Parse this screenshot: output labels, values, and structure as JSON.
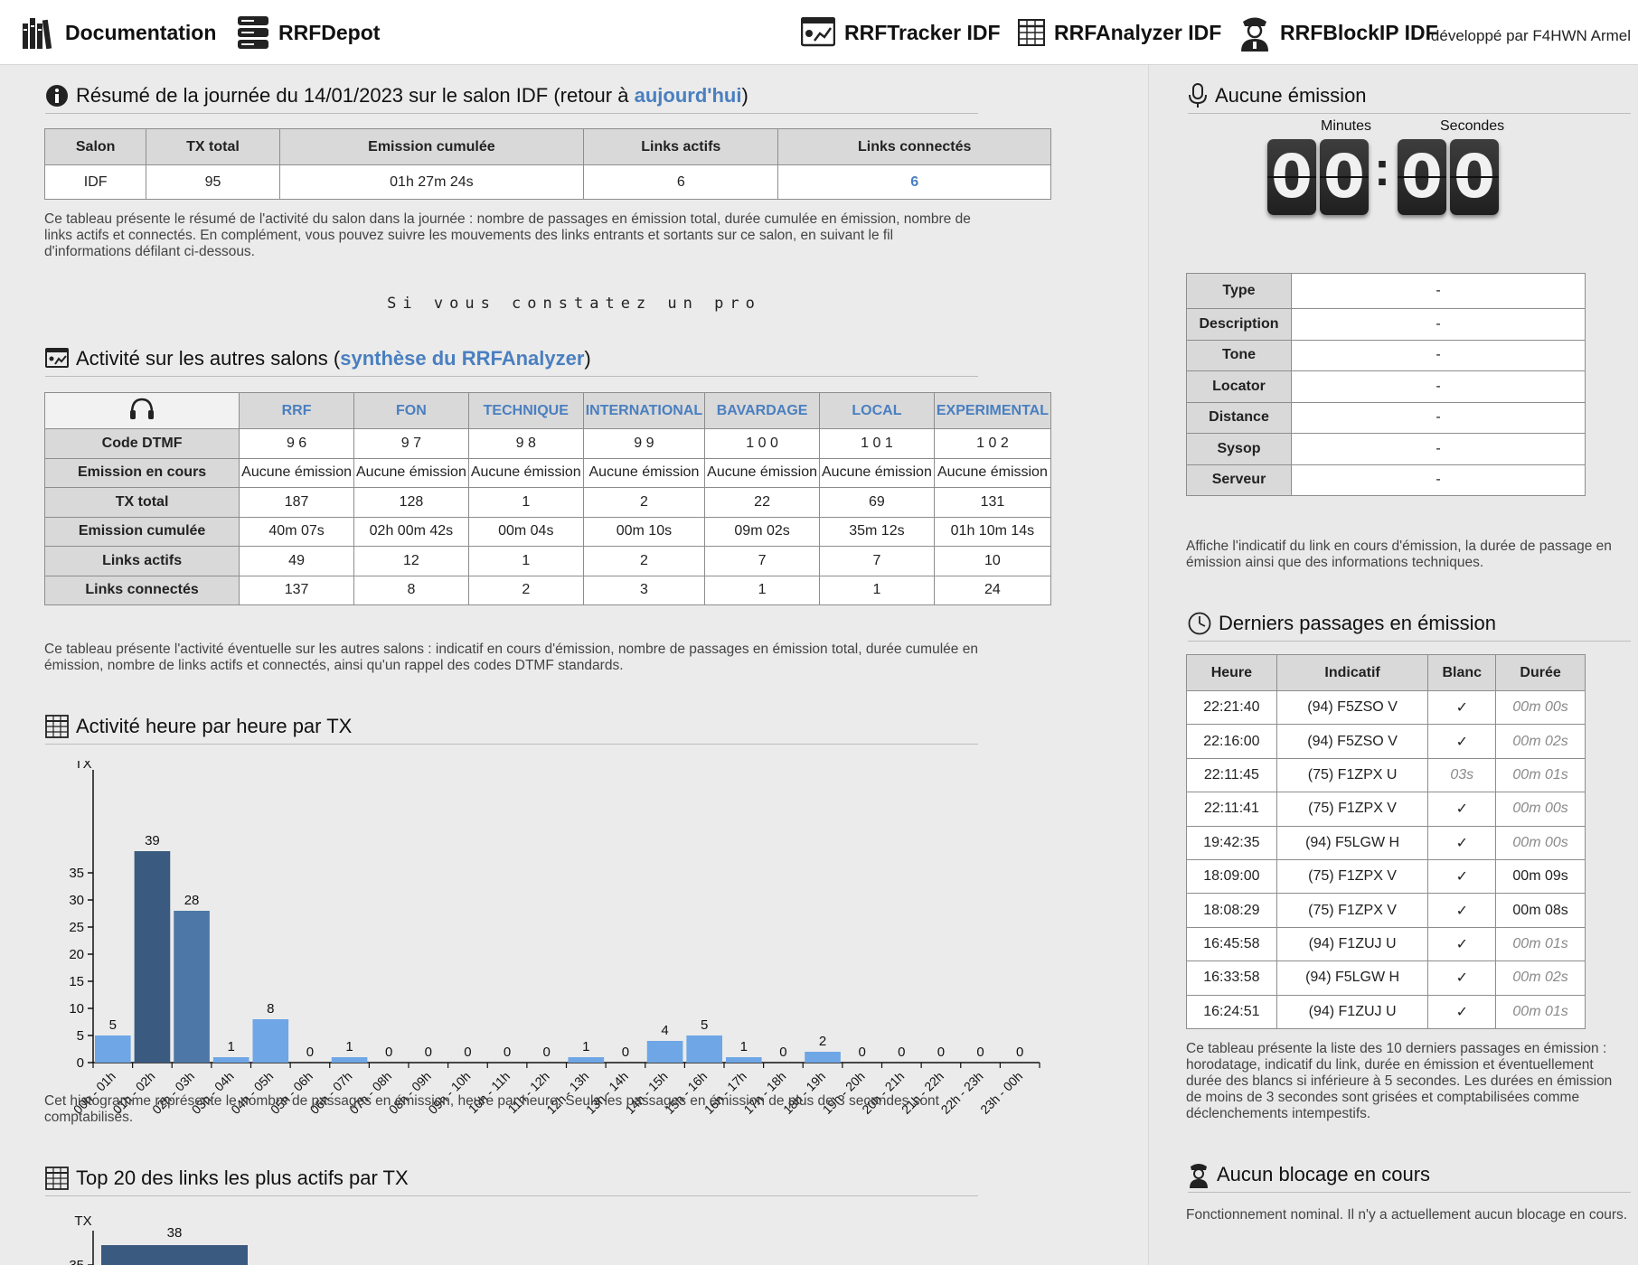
{
  "nav": {
    "documentation": "Documentation",
    "depot": "RRFDepot",
    "tracker": "RRFTracker IDF",
    "analyzer": "RRFAnalyzer IDF",
    "blockip": "RRFBlockIP IDF",
    "credit": "développé par F4HWN Armel"
  },
  "summary": {
    "title_prefix": "Résumé de la journée du 14/01/2023 sur le salon IDF (retour à ",
    "title_link": "aujourd'hui",
    "title_suffix": ")",
    "headers": [
      "Salon",
      "TX total",
      "Emission cumulée",
      "Links actifs",
      "Links connectés"
    ],
    "values": [
      "IDF",
      "95",
      "01h 27m 24s",
      "6",
      "6"
    ],
    "description": "Ce tableau présente le résumé de l'activité du salon dans la journée : nombre de passages en émission total, durée cumulée en émission, nombre de links actifs et connectés. En complément, vous pouvez suivre les mouvements des links entrants et sortants sur ce salon, en suivant le fil d'informations défilant ci-dessous."
  },
  "marquee": "Si vous constatez un pro",
  "other_salons": {
    "title_prefix": "Activité sur les autres salons (",
    "title_link": "synthèse du RRFAnalyzer",
    "title_suffix": ")",
    "salons": [
      "RRF",
      "FON",
      "TECHNIQUE",
      "INTERNATIONAL",
      "BAVARDAGE",
      "LOCAL",
      "EXPERIMENTAL"
    ],
    "rows": [
      {
        "label": "Code DTMF",
        "values": [
          "9 6",
          "9 7",
          "9 8",
          "9 9",
          "1 0 0",
          "1 0 1",
          "1 0 2"
        ]
      },
      {
        "label": "Emission en cours",
        "values": [
          "Aucune émission",
          "Aucune émission",
          "Aucune émission",
          "Aucune émission",
          "Aucune émission",
          "Aucune émission",
          "Aucune émission"
        ]
      },
      {
        "label": "TX total",
        "values": [
          "187",
          "128",
          "1",
          "2",
          "22",
          "69",
          "131"
        ]
      },
      {
        "label": "Emission cumulée",
        "values": [
          "40m 07s",
          "02h 00m 42s",
          "00m 04s",
          "00m 10s",
          "09m 02s",
          "35m 12s",
          "01h 10m 14s"
        ]
      },
      {
        "label": "Links actifs",
        "values": [
          "49",
          "12",
          "1",
          "2",
          "7",
          "7",
          "10"
        ]
      },
      {
        "label": "Links connectés",
        "values": [
          "137",
          "8",
          "2",
          "3",
          "1",
          "1",
          "24"
        ]
      }
    ],
    "description": "Ce tableau présente l'activité éventuelle sur les autres salons : indicatif en cours d'émission, nombre de passages en émission total, durée cumulée en émission, nombre de links actifs et connectés, ainsi qu'un rappel des codes DTMF standards."
  },
  "hourly": {
    "title": "Activité heure par heure par TX",
    "description": "Cet histogramme représente le nombre de passages en émission, heure par heure. Seuls les passages en émission de plus de 3 secondes sont comptabilisés."
  },
  "chart_data": [
    {
      "type": "bar",
      "title": "Activité heure par heure par TX",
      "ylabel": "TX",
      "xlabel": "",
      "ylim": [
        0,
        39
      ],
      "yticks": [
        0,
        5,
        10,
        15,
        20,
        25,
        30,
        35
      ],
      "categories": [
        "00h - 01h",
        "01h - 02h",
        "02h - 03h",
        "03h - 04h",
        "04h - 05h",
        "05h - 06h",
        "06h - 07h",
        "07h - 08h",
        "08h - 09h",
        "09h - 10h",
        "10h - 11h",
        "11h - 12h",
        "12h - 13h",
        "13h - 14h",
        "14h - 15h",
        "15h - 16h",
        "16h - 17h",
        "17h - 18h",
        "18h - 19h",
        "19h - 20h",
        "20h - 21h",
        "21h - 22h",
        "22h - 23h",
        "23h - 00h"
      ],
      "values": [
        5,
        39,
        28,
        1,
        8,
        0,
        1,
        0,
        0,
        0,
        0,
        0,
        1,
        0,
        4,
        5,
        1,
        0,
        2,
        0,
        0,
        0,
        0,
        0
      ],
      "colors": {
        "normal": "#6ea6e6",
        "top": "#3a5a80",
        "second": "#4d77a6"
      }
    },
    {
      "type": "bar",
      "title": "Top 20 des links les plus actifs par TX",
      "ylabel": "TX",
      "yticks": [
        35
      ],
      "values": [
        38
      ],
      "colors": {
        "normal": "#3a5a80"
      }
    }
  ],
  "top20": {
    "title": "Top 20 des links les plus actifs par TX"
  },
  "emission": {
    "title": "Aucune émission",
    "minutes_label": "Minutes",
    "seconds_label": "Secondes",
    "digits": [
      "0",
      "0",
      "0",
      "0"
    ],
    "colon": ":",
    "info_rows": [
      {
        "label": "Type",
        "value": "-"
      },
      {
        "label": "Description",
        "value": "-"
      },
      {
        "label": "Tone",
        "value": "-"
      },
      {
        "label": "Locator",
        "value": "-"
      },
      {
        "label": "Distance",
        "value": "-"
      },
      {
        "label": "Sysop",
        "value": "-"
      },
      {
        "label": "Serveur",
        "value": "-"
      }
    ],
    "description": "Affiche l'indicatif du link en cours d'émission, la durée de passage en émission ainsi que des informations techniques."
  },
  "last": {
    "title": "Derniers passages en émission",
    "headers": [
      "Heure",
      "Indicatif",
      "Blanc",
      "Durée"
    ],
    "rows": [
      {
        "heure": "22:21:40",
        "indicatif": "(94) F5ZSO V",
        "blanc": "✓",
        "duree": "00m 00s",
        "blanc_gray": false,
        "duree_gray": true
      },
      {
        "heure": "22:16:00",
        "indicatif": "(94) F5ZSO V",
        "blanc": "✓",
        "duree": "00m 02s",
        "blanc_gray": false,
        "duree_gray": true
      },
      {
        "heure": "22:11:45",
        "indicatif": "(75) F1ZPX U",
        "blanc": "03s",
        "duree": "00m 01s",
        "blanc_gray": true,
        "duree_gray": true
      },
      {
        "heure": "22:11:41",
        "indicatif": "(75) F1ZPX V",
        "blanc": "✓",
        "duree": "00m 00s",
        "blanc_gray": false,
        "duree_gray": true
      },
      {
        "heure": "19:42:35",
        "indicatif": "(94) F5LGW H",
        "blanc": "✓",
        "duree": "00m 00s",
        "blanc_gray": false,
        "duree_gray": true
      },
      {
        "heure": "18:09:00",
        "indicatif": "(75) F1ZPX V",
        "blanc": "✓",
        "duree": "00m 09s",
        "blanc_gray": false,
        "duree_gray": false
      },
      {
        "heure": "18:08:29",
        "indicatif": "(75) F1ZPX V",
        "blanc": "✓",
        "duree": "00m 08s",
        "blanc_gray": false,
        "duree_gray": false
      },
      {
        "heure": "16:45:58",
        "indicatif": "(94) F1ZUJ U",
        "blanc": "✓",
        "duree": "00m 01s",
        "blanc_gray": false,
        "duree_gray": true
      },
      {
        "heure": "16:33:58",
        "indicatif": "(94) F5LGW H",
        "blanc": "✓",
        "duree": "00m 02s",
        "blanc_gray": false,
        "duree_gray": true
      },
      {
        "heure": "16:24:51",
        "indicatif": "(94) F1ZUJ U",
        "blanc": "✓",
        "duree": "00m 01s",
        "blanc_gray": false,
        "duree_gray": true
      }
    ],
    "description": "Ce tableau présente la liste des 10 derniers passages en émission : horodatage, indicatif du link, durée en émission et éventuellement durée des blancs si inférieure à 5 secondes. Les durées en émission de moins de 3 secondes sont grisées et comptabilisées comme déclenchements intempestifs."
  },
  "blocking": {
    "title": "Aucun blocage en cours",
    "description": "Fonctionnement nominal. Il n'y a actuellement aucun blocage en cours."
  }
}
